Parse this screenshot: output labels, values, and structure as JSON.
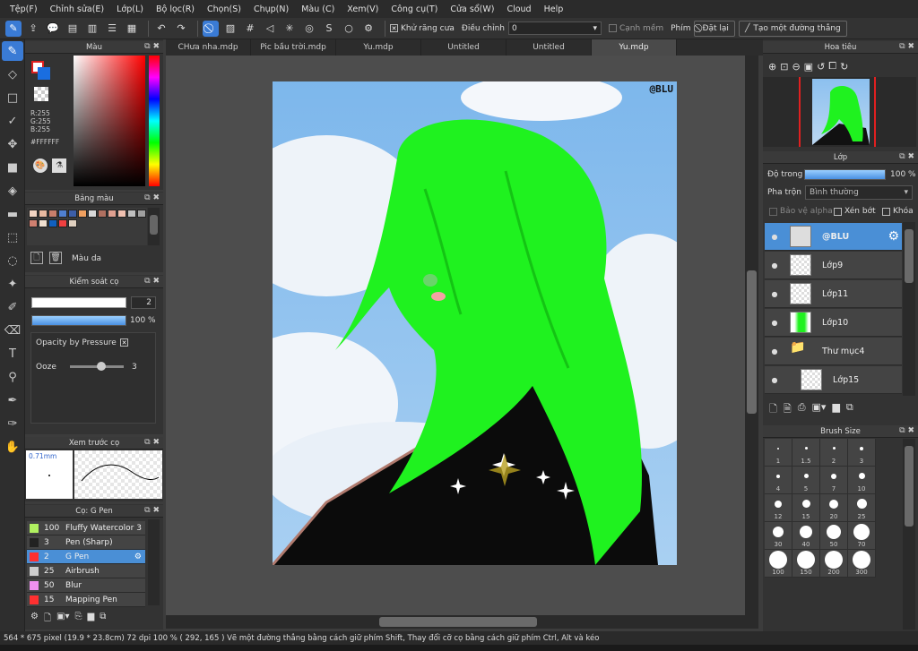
{
  "menu": [
    "Tệp(F)",
    "Chỉnh sửa(E)",
    "Lớp(L)",
    "Bộ lọc(R)",
    "Chọn(S)",
    "Chụp(N)",
    "Màu (C)",
    "Xem(V)",
    "Công cụ(T)",
    "Cửa sổ(W)",
    "Cloud",
    "Help"
  ],
  "toolbar": {
    "antialias": "Khử răng cưa",
    "adjust": "Điều chỉnh",
    "adjust_value": "0",
    "edge": "Cạnh mềm",
    "key_label": "Phím",
    "reset": "Đặt lại",
    "line": "Tạo một đường thẳng"
  },
  "tabs": [
    "CHưa nha.mdp",
    "Pic bầu trời.mdp",
    "Yu.mdp",
    "Untitled",
    "Untitled",
    "Yu.mdp"
  ],
  "color_panel": {
    "title": "Màu",
    "r": "R:255",
    "g": "G:255",
    "b": "B:255",
    "hex": "#FFFFFF"
  },
  "palette": {
    "title": "Bảng màu",
    "name": "Màu da",
    "swatches": [
      "#f2d5c4",
      "#e8b9a0",
      "#c97f6b",
      "#4f7fd0",
      "#3d5ea8",
      "#f0a060",
      "#d8d8d8",
      "#b07060",
      "#e0a090",
      "#f0c0b0",
      "#c0c0c0",
      "#a0a0a0",
      "#d08070",
      "#f0e0d0",
      "#1060c0",
      "#f04040",
      "#e0d0c0"
    ]
  },
  "brush_control": {
    "title": "Kiểm soát cọ",
    "size": "2",
    "opacity": "100 %",
    "opacity_level": 1.0,
    "pressure": "Opacity by Pressure",
    "ooze_label": "Ooze",
    "ooze_value": "3"
  },
  "preview": {
    "title": "Xem trước cọ",
    "size": "0.71mm"
  },
  "brush_list": {
    "title": "Cọ: G Pen",
    "items": [
      {
        "size": "100",
        "name": "Fluffy Watercolor 3",
        "color": "#b0f060"
      },
      {
        "size": "3",
        "name": "Pen (Sharp)",
        "color": "#222222"
      },
      {
        "size": "2",
        "name": "G Pen",
        "color": "#ff3030"
      },
      {
        "size": "25",
        "name": "Airbrush",
        "color": "#cccccc"
      },
      {
        "size": "50",
        "name": "Blur",
        "color": "#f090f0"
      },
      {
        "size": "15",
        "name": "Mapping Pen",
        "color": "#ff3030"
      }
    ]
  },
  "navigator": {
    "title": "Hoa tiêu"
  },
  "layers": {
    "title": "Lớp",
    "opacity_label": "Độ trong",
    "opacity": "100 %",
    "opacity_level": 1.0,
    "blend_label": "Pha trộn",
    "blend": "Bình thường",
    "protect": "Bảo vệ alpha",
    "clip": "Xén bớt",
    "lock": "Khóa",
    "items": [
      {
        "name": "@BLU"
      },
      {
        "name": "Lớp9"
      },
      {
        "name": "Lớp11"
      },
      {
        "name": "Lớp10"
      },
      {
        "name": "Thư mục4"
      },
      {
        "name": "Lớp15"
      }
    ]
  },
  "brush_size": {
    "title": "Brush Size",
    "sizes": [
      "1",
      "1.5",
      "2",
      "3",
      "4",
      "5",
      "7",
      "10",
      "12",
      "15",
      "20",
      "25",
      "30",
      "40",
      "50",
      "70",
      "100",
      "150",
      "200",
      "300"
    ]
  },
  "status": "564 * 675 pixel   (19.9 * 23.8cm)   72 dpi   100 %   ( 292, 165 )   Vẽ một đường thẳng bằng cách giữ phím Shift, Thay đổi cỡ cọ bằng cách giữ phím Ctrl, Alt và kéo",
  "watermark": "@BLU"
}
